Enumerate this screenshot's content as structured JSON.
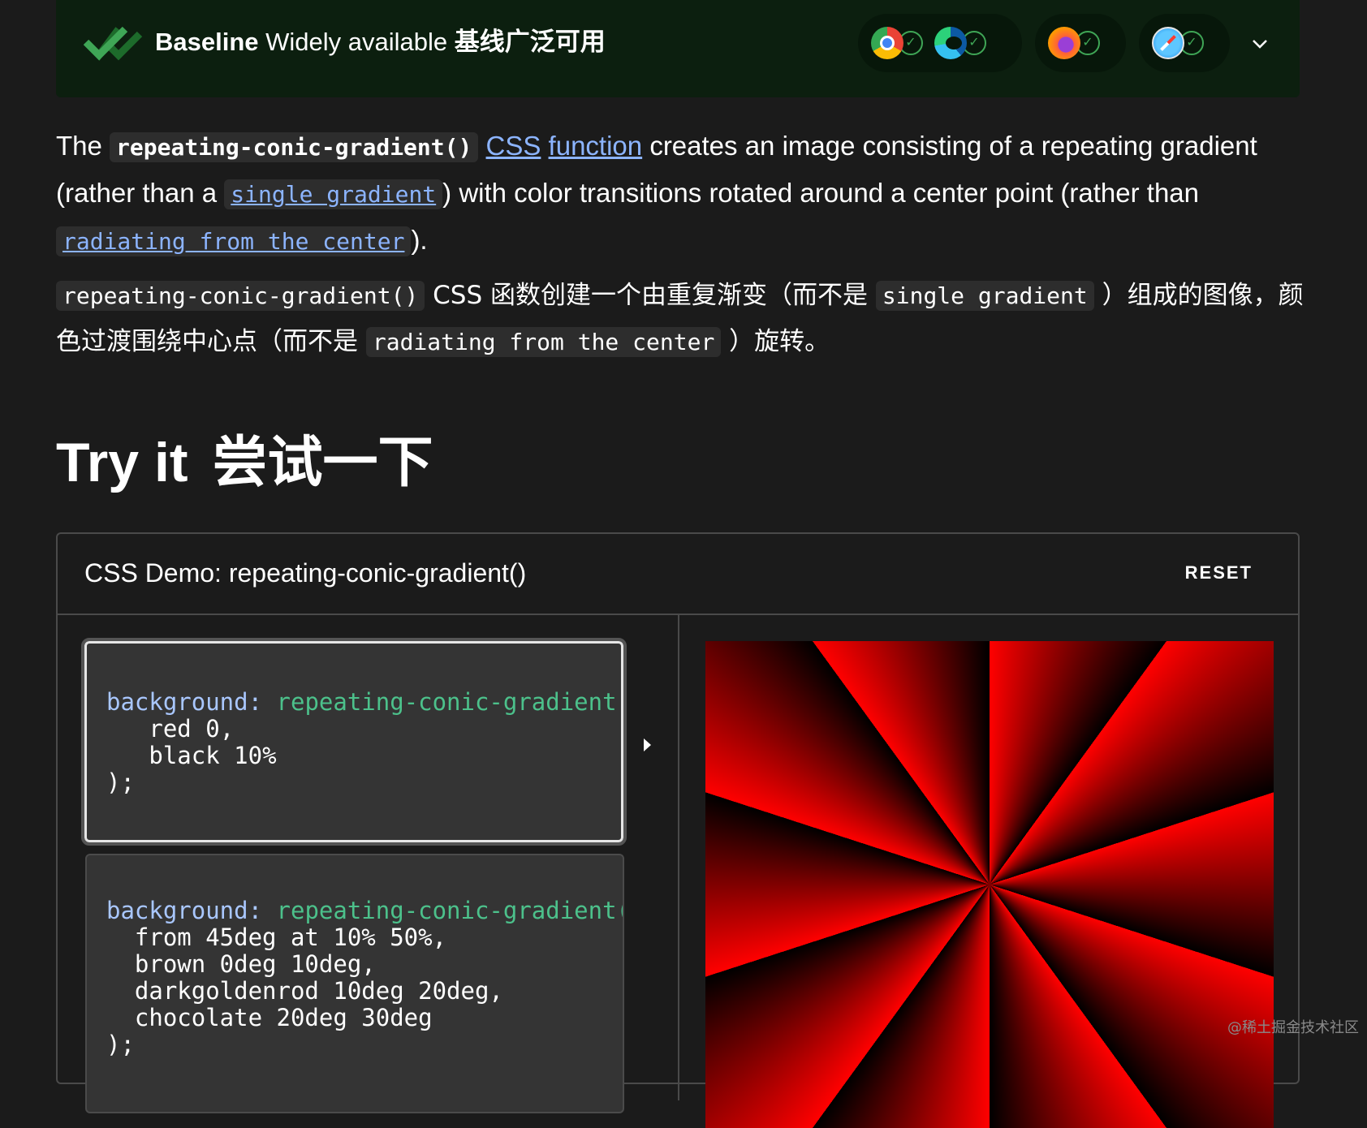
{
  "baseline": {
    "label_bold": "Baseline",
    "label_rest": "Widely available",
    "label_zh": "基线广泛可用",
    "check_glyph": "✓",
    "browsers": [
      "chrome-icon",
      "edge-icon",
      "firefox-icon",
      "safari-icon"
    ],
    "status_color": "#3fa656"
  },
  "intro_en": {
    "the": "The",
    "fn_code": "repeating-conic-gradient()",
    "link_css": "CSS",
    "link_function": "function",
    "text1": "creates an image consisting of a repeating gradient (rather than a",
    "link_single": "single gradient",
    "text2": ") with color transitions rotated around a center point (rather than",
    "link_radiating": "radiating from the center",
    "text3": ")."
  },
  "intro_zh": {
    "fn_code": "repeating-conic-gradient()",
    "text1": "CSS 函数创建一个由重复渐变（而不是",
    "code_single": "single gradient",
    "text2": "）组成的图像，颜色过渡围绕中心点（而不是",
    "code_radiating": "radiating from the center",
    "text3": "）旋转。"
  },
  "heading": {
    "en": "Try it",
    "zh": "尝试一下"
  },
  "demo": {
    "title": "CSS Demo: repeating-conic-gradient()",
    "reset_label": "RESET",
    "examples": [
      {
        "prop": "background:",
        "fn": "repeating-conic-gradient(",
        "line2": "red 0,",
        "line3": "black 10%",
        "close": ");"
      },
      {
        "prop": "background:",
        "fn": "repeating-conic-gradient(",
        "line2": "from 45deg at 10% 50%,",
        "line3": "brown 0deg 10deg,",
        "line4": "darkgoldenrod 10deg 20deg,",
        "line5": "chocolate 20deg 30deg",
        "close": ");"
      }
    ],
    "output_colors": [
      "red",
      "black"
    ]
  },
  "watermark": "@稀土掘金技术社区"
}
